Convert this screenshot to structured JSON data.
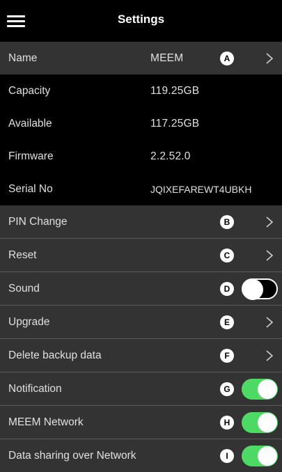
{
  "header": {
    "title": "Settings"
  },
  "info": {
    "name_label": "Name",
    "name_value": "MEEM",
    "name_badge": "A",
    "capacity_label": "Capacity",
    "capacity_value": "119.25GB",
    "available_label": "Available",
    "available_value": "117.25GB",
    "firmware_label": "Firmware",
    "firmware_value": "2.2.52.0",
    "serial_label": "Serial No",
    "serial_value": "JQIXEFAREWT4UBKH"
  },
  "settings": [
    {
      "label": "PIN Change",
      "badge": "B",
      "control": "chevron"
    },
    {
      "label": "Reset",
      "badge": "C",
      "control": "chevron"
    },
    {
      "label": "Sound",
      "badge": "D",
      "control": "toggle",
      "on": false
    },
    {
      "label": "Upgrade",
      "badge": "E",
      "control": "chevron"
    },
    {
      "label": "Delete backup data",
      "badge": "F",
      "control": "chevron"
    },
    {
      "label": "Notification",
      "badge": "G",
      "control": "toggle",
      "on": true
    },
    {
      "label": "MEEM Network",
      "badge": "H",
      "control": "toggle",
      "on": true
    },
    {
      "label": "Data sharing over Network",
      "badge": "I",
      "control": "toggle",
      "on": true
    }
  ],
  "colors": {
    "row_gray": "#333333",
    "toggle_on": "#4cd964",
    "background": "#000000"
  },
  "icons": {
    "menu": "hamburger-icon",
    "chevron": "chevron-right-icon"
  }
}
